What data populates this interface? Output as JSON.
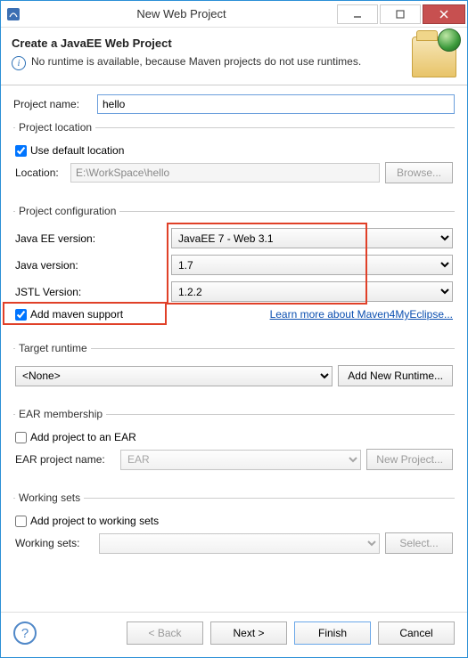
{
  "window": {
    "title": "New Web Project"
  },
  "header": {
    "title": "Create a JavaEE Web Project",
    "info": "No runtime is available, because Maven projects do not use runtimes."
  },
  "projectName": {
    "label": "Project name:",
    "value": "hello"
  },
  "location": {
    "legend": "Project location",
    "useDefault": "Use default location",
    "locationLabel": "Location:",
    "locationValue": "E:\\WorkSpace\\hello",
    "browse": "Browse..."
  },
  "config": {
    "legend": "Project configuration",
    "javaEE": {
      "label": "Java EE version:",
      "value": "JavaEE 7 - Web 3.1"
    },
    "java": {
      "label": "Java version:",
      "value": "1.7"
    },
    "jstl": {
      "label": "JSTL Version:",
      "value": "1.2.2"
    },
    "maven": "Add maven support",
    "learnMore": "Learn more about Maven4MyEclipse..."
  },
  "runtime": {
    "legend": "Target runtime",
    "value": "<None>",
    "addBtn": "Add New Runtime..."
  },
  "ear": {
    "legend": "EAR membership",
    "addToEar": "Add project to an EAR",
    "nameLabel": "EAR project name:",
    "nameValue": "EAR",
    "newBtn": "New Project..."
  },
  "ws": {
    "legend": "Working sets",
    "add": "Add project to working sets",
    "label": "Working sets:",
    "select": "Select..."
  },
  "footer": {
    "back": "< Back",
    "next": "Next >",
    "finish": "Finish",
    "cancel": "Cancel"
  }
}
